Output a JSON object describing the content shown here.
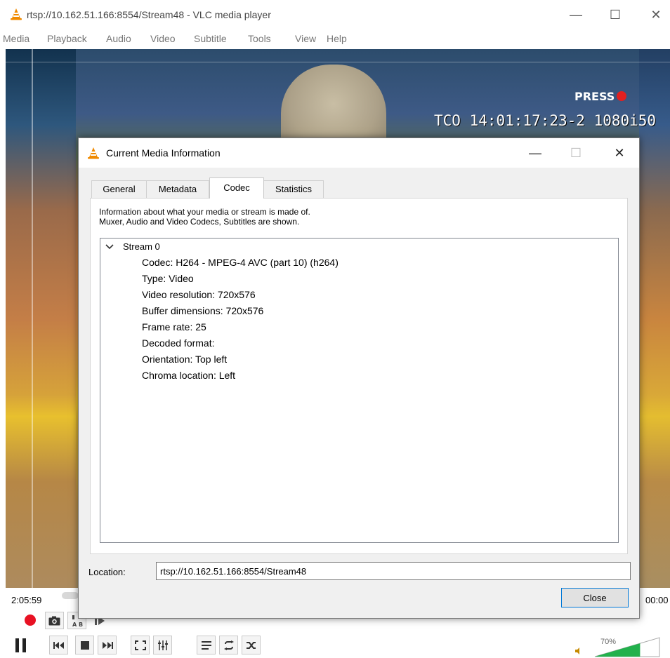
{
  "window": {
    "title": "rtsp://10.162.51.166:8554/Stream48 - VLC media player",
    "minimize": "—",
    "maximize": "☐",
    "close": "✕"
  },
  "menu": [
    "Media",
    "Playback",
    "Audio",
    "Video",
    "Subtitle",
    "Tools",
    "View",
    "Help"
  ],
  "video": {
    "overlay_press": "PRESS",
    "overlay_timecode": "TCO 14:01:17:23-2 1080i50"
  },
  "dialog": {
    "title": "Current Media Information",
    "minimize": "—",
    "maximize": "☐",
    "close": "✕",
    "tabs": [
      "General",
      "Metadata",
      "Codec",
      "Statistics"
    ],
    "active_tab": "Codec",
    "description_line1": "Information about what your media or stream is made of.",
    "description_line2": "Muxer, Audio and Video Codecs, Subtitles are shown.",
    "stream": {
      "label": "Stream 0",
      "properties": [
        "Codec: H264 - MPEG-4 AVC (part 10) (h264)",
        "Type: Video",
        "Video resolution: 720x576",
        "Buffer dimensions: 720x576",
        "Frame rate: 25",
        "Decoded format:",
        "Orientation: Top left",
        "Chroma location: Left"
      ]
    },
    "location_label": "Location:",
    "location_value": "rtsp://10.162.51.166:8554/Stream48",
    "close_button": "Close"
  },
  "player": {
    "time_elapsed": "2:05:59",
    "time_total": "00:00",
    "volume_percent": "70%",
    "volume_level": 0.7,
    "record_color": "#e81123",
    "accent_volume": "#22b14c"
  }
}
